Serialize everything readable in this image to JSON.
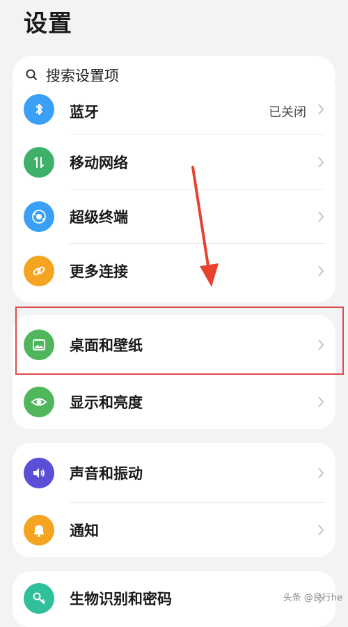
{
  "title": "设置",
  "search": {
    "placeholder": "搜索设置项"
  },
  "card1": [
    {
      "label": "蓝牙",
      "value": "已关闭",
      "icon": "bluetooth-icon",
      "color": "#3aa0f5"
    },
    {
      "label": "移动网络",
      "icon": "mobile-data-icon",
      "color": "#3fb06a"
    },
    {
      "label": "超级终端",
      "icon": "super-device-icon",
      "color": "#3aa0f5"
    },
    {
      "label": "更多连接",
      "icon": "link-icon",
      "color": "#f5a422"
    }
  ],
  "card2": [
    {
      "label": "桌面和壁纸",
      "icon": "image-icon",
      "color": "#4fb65c"
    },
    {
      "label": "显示和亮度",
      "icon": "eye-icon",
      "color": "#4fb65c"
    }
  ],
  "card3": [
    {
      "label": "声音和振动",
      "icon": "speaker-icon",
      "color": "#5b4fd8"
    },
    {
      "label": "通知",
      "icon": "bell-icon",
      "color": "#f5a422"
    }
  ],
  "card4": [
    {
      "label": "生物识别和密码",
      "icon": "key-icon",
      "color": "#2fbf9a"
    }
  ],
  "watermark": "头条 @良行he"
}
